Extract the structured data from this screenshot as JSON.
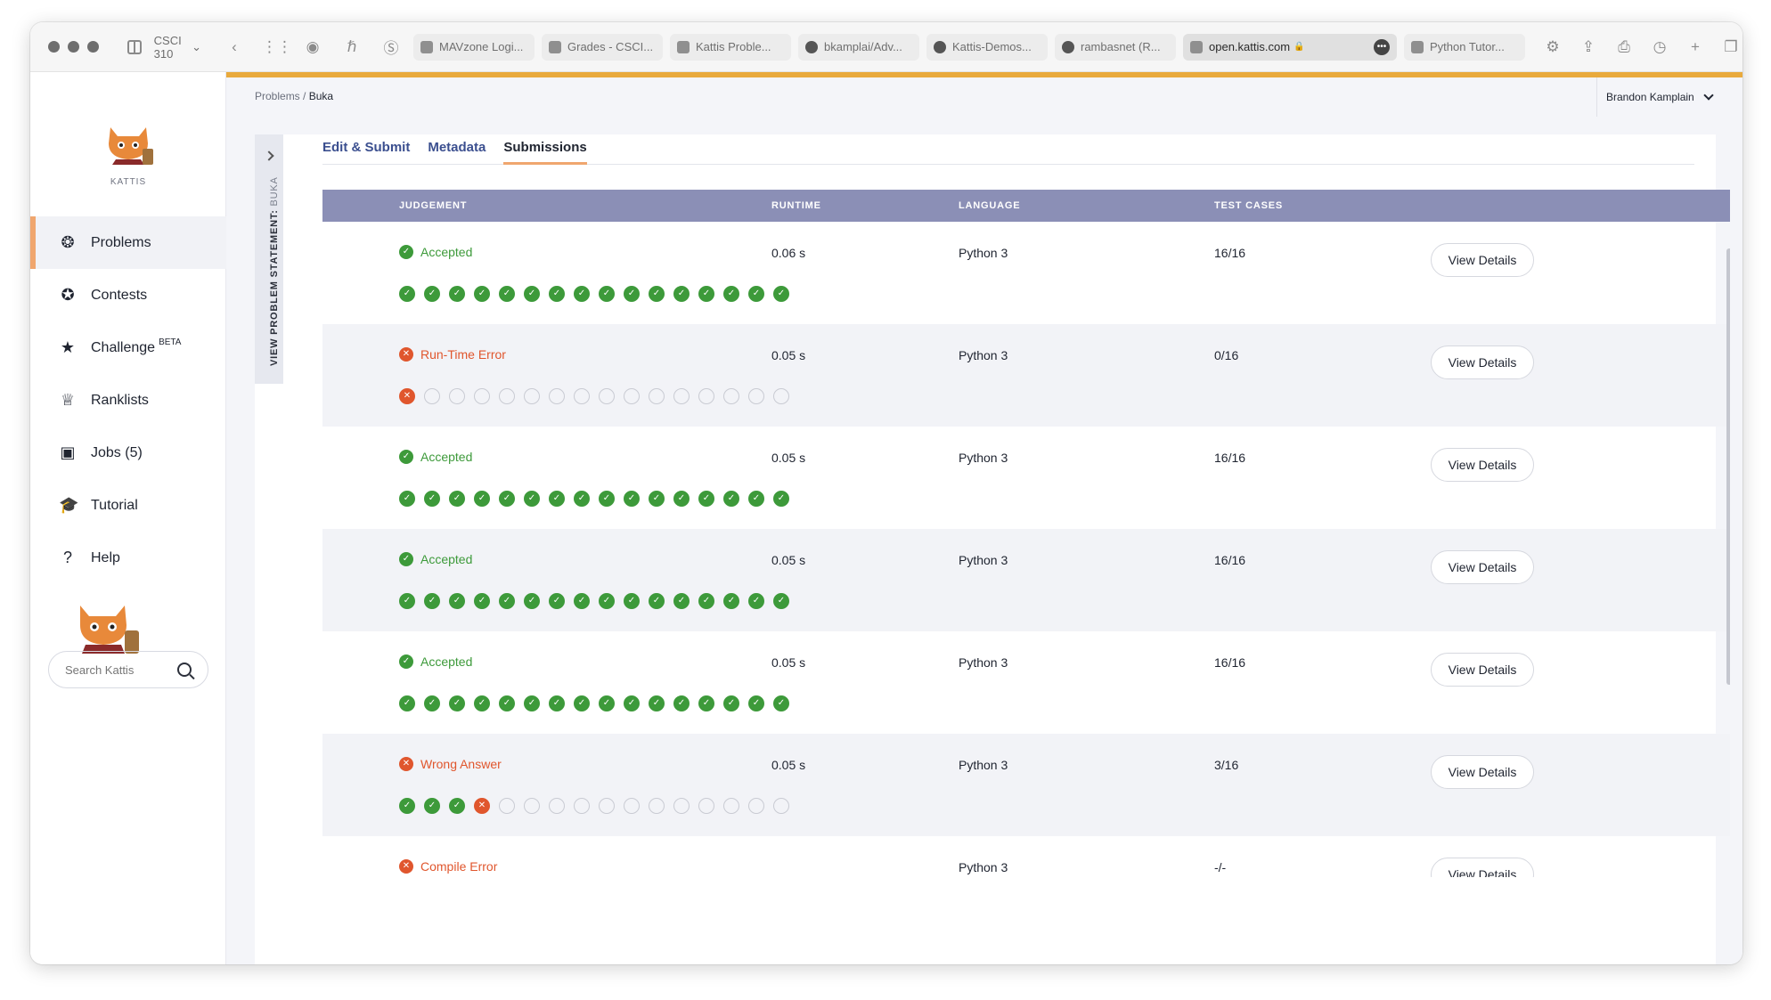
{
  "browser": {
    "tab_group": "CSCI 310",
    "tabs": [
      {
        "label": "MAVzone Logi...",
        "icon": "mav-icon"
      },
      {
        "label": "Grades - CSCI...",
        "icon": "d2l-icon"
      },
      {
        "label": "Kattis Proble...",
        "icon": "doc-icon"
      },
      {
        "label": "bkamplai/Adv...",
        "icon": "github-icon"
      },
      {
        "label": "Kattis-Demos...",
        "icon": "github-icon"
      },
      {
        "label": "rambasnet (R...",
        "icon": "github-icon"
      },
      {
        "label": "open.kattis.com",
        "icon": "kattis-icon",
        "active": true
      },
      {
        "label": "Python Tutor...",
        "icon": "python-icon"
      }
    ]
  },
  "sidebar": {
    "logo_text": "KATTIS",
    "items": [
      {
        "label": "Problems",
        "icon": "brain-icon",
        "active": true
      },
      {
        "label": "Contests",
        "icon": "medal-icon"
      },
      {
        "label": "Challenge",
        "icon": "star-icon",
        "badge": "BETA"
      },
      {
        "label": "Ranklists",
        "icon": "trophy-icon"
      },
      {
        "label": "Jobs (5)",
        "icon": "briefcase-icon"
      },
      {
        "label": "Tutorial",
        "icon": "graduation-cap-icon"
      },
      {
        "label": "Help",
        "icon": "question-icon"
      }
    ],
    "search_placeholder": "Search Kattis"
  },
  "breadcrumb": {
    "parent": "Problems",
    "separator": "/",
    "current": "Buka"
  },
  "user": {
    "name": "Brandon Kamplain"
  },
  "problem": {
    "side_label": "VIEW PROBLEM STATEMENT:",
    "side_name": "BUKA",
    "tabs": [
      "Edit & Submit",
      "Metadata",
      "Submissions"
    ],
    "active_tab": "Submissions"
  },
  "table": {
    "headers": {
      "judgement": "JUDGEMENT",
      "runtime": "RUNTIME",
      "language": "LANGUAGE",
      "test_cases": "TEST CASES"
    },
    "details_label": "View Details",
    "rows": [
      {
        "judgement": "Accepted",
        "status": "ok",
        "runtime": "0.06 s",
        "language": "Python 3",
        "test_cases": "16/16",
        "passed": 16,
        "failed_at": null
      },
      {
        "judgement": "Run-Time Error",
        "status": "bad",
        "runtime": "0.05 s",
        "language": "Python 3",
        "test_cases": "0/16",
        "passed": 0,
        "failed_at": 1
      },
      {
        "judgement": "Accepted",
        "status": "ok",
        "runtime": "0.05 s",
        "language": "Python 3",
        "test_cases": "16/16",
        "passed": 16,
        "failed_at": null
      },
      {
        "judgement": "Accepted",
        "status": "ok",
        "runtime": "0.05 s",
        "language": "Python 3",
        "test_cases": "16/16",
        "passed": 16,
        "failed_at": null
      },
      {
        "judgement": "Accepted",
        "status": "ok",
        "runtime": "0.05 s",
        "language": "Python 3",
        "test_cases": "16/16",
        "passed": 16,
        "failed_at": null
      },
      {
        "judgement": "Wrong Answer",
        "status": "bad",
        "runtime": "0.05 s",
        "language": "Python 3",
        "test_cases": "3/16",
        "passed": 3,
        "failed_at": 4
      },
      {
        "judgement": "Compile Error",
        "status": "bad",
        "runtime": "",
        "language": "Python 3",
        "test_cases": "-/-",
        "passed": 0,
        "failed_at": null
      }
    ],
    "total_tests": 16
  },
  "colors": {
    "accent": "#e9aa3c",
    "header": "#8b8fb6",
    "ok": "#3d9a3a",
    "bad": "#e0562d",
    "link": "#3b4f8f"
  }
}
